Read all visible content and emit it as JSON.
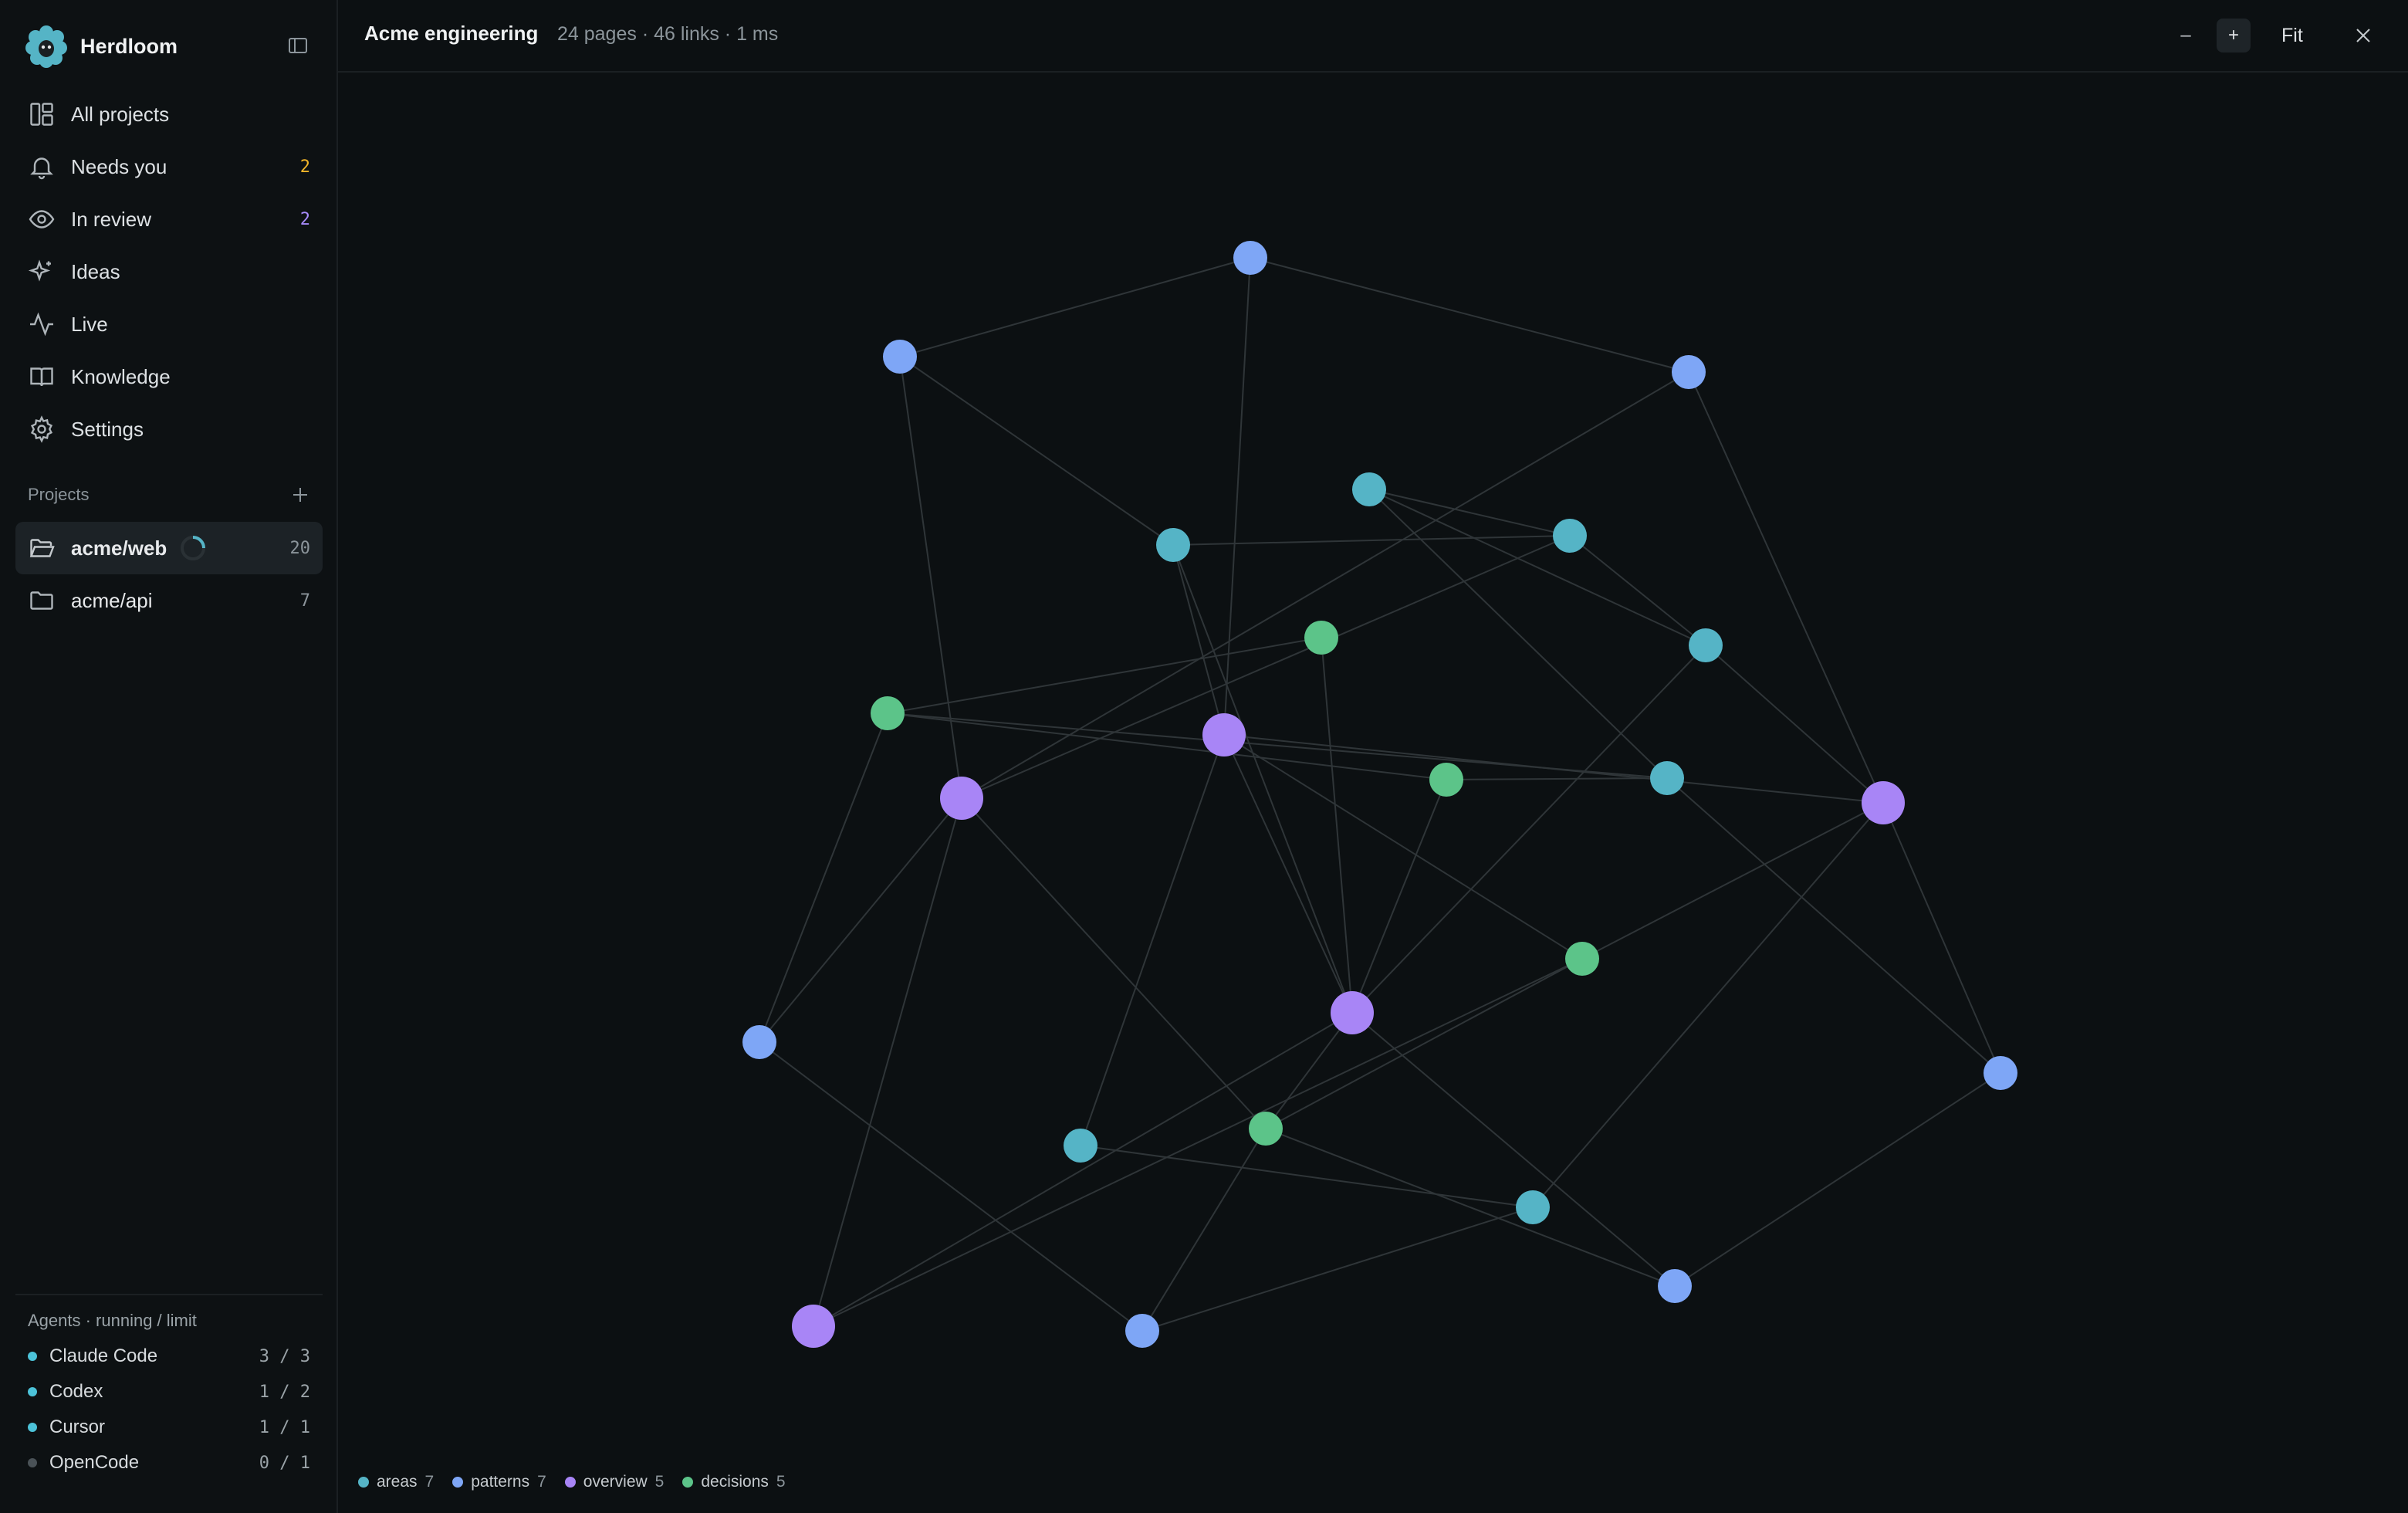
{
  "app": {
    "name": "Herdloom"
  },
  "nav": {
    "items": [
      {
        "label": "All projects",
        "icon": "grid-icon",
        "badge": ""
      },
      {
        "label": "Needs you",
        "icon": "bell-icon",
        "badge": "2",
        "badge_color": "#f0b429"
      },
      {
        "label": "In review",
        "icon": "eye-icon",
        "badge": "2",
        "badge_color": "#a78bfa"
      },
      {
        "label": "Ideas",
        "icon": "sparkle-icon",
        "badge": ""
      },
      {
        "label": "Live",
        "icon": "activity-icon",
        "badge": ""
      },
      {
        "label": "Knowledge",
        "icon": "book-icon",
        "badge": ""
      },
      {
        "label": "Settings",
        "icon": "gear-icon",
        "badge": ""
      }
    ]
  },
  "projects": {
    "title": "Projects",
    "items": [
      {
        "label": "acme/web",
        "count": "20",
        "active": true,
        "loading": true
      },
      {
        "label": "acme/api",
        "count": "7",
        "active": false,
        "loading": false
      }
    ]
  },
  "agents": {
    "title": "Agents · running / limit",
    "items": [
      {
        "name": "Claude Code",
        "count": "3 / 3",
        "color": "#4cc3d9"
      },
      {
        "name": "Codex",
        "count": "1 / 2",
        "color": "#4cc3d9"
      },
      {
        "name": "Cursor",
        "count": "1 / 1",
        "color": "#4cc3d9"
      },
      {
        "name": "OpenCode",
        "count": "0 / 1",
        "color": "#4a5257"
      }
    ]
  },
  "graph": {
    "title": "Acme engineering",
    "meta": "24 pages · 46 links · 1 ms",
    "controls": {
      "zoom_out": "–",
      "zoom_in": "+",
      "fit": "Fit"
    },
    "colors": {
      "areas": "#55b4c6",
      "patterns": "#7ea6f6",
      "overview": "#a885f6",
      "decisions": "#5cc489",
      "edge": "#2f3538",
      "background": "#0c1012"
    },
    "legend": [
      {
        "key": "areas",
        "label": "areas",
        "count": "7"
      },
      {
        "key": "patterns",
        "label": "patterns",
        "count": "7"
      },
      {
        "key": "overview",
        "label": "overview",
        "count": "5"
      },
      {
        "key": "decisions",
        "label": "decisions",
        "count": "5"
      }
    ]
  }
}
